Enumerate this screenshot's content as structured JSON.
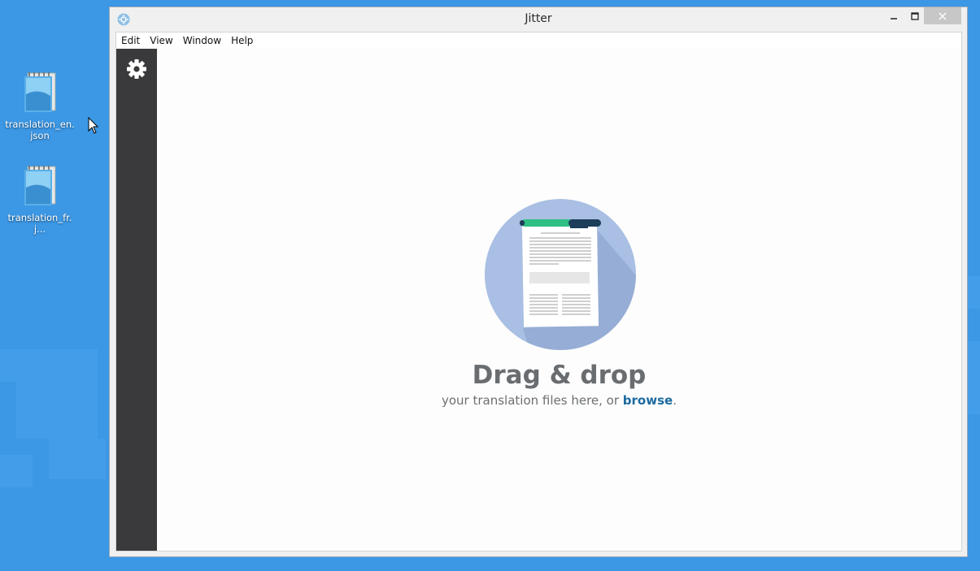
{
  "desktop": {
    "icons": [
      {
        "label": "translation_en.json",
        "icon": "notepad-file-icon"
      },
      {
        "label": "translation_fr.j...",
        "icon": "notepad-file-icon"
      }
    ]
  },
  "window": {
    "title": "Jitter",
    "app_icon": "jitter-app-icon",
    "controls": {
      "minimize": "–",
      "maximize": "□",
      "close": "✕"
    }
  },
  "menubar": {
    "items": [
      {
        "label": "Edit"
      },
      {
        "label": "View"
      },
      {
        "label": "Window"
      },
      {
        "label": "Help"
      }
    ]
  },
  "sidebar": {
    "settings_icon": "gear-icon"
  },
  "dropzone": {
    "title": "Drag & drop",
    "subtitle_prefix": "your translation files here, or ",
    "browse_link": "browse",
    "subtitle_suffix": "."
  },
  "colors": {
    "desktop": "#3c97e4",
    "sidebar": "#3a3a3c",
    "accent_link": "#1b6aa0",
    "illustration_circle": "#a9bfe3",
    "pen": "#2fbf85"
  }
}
